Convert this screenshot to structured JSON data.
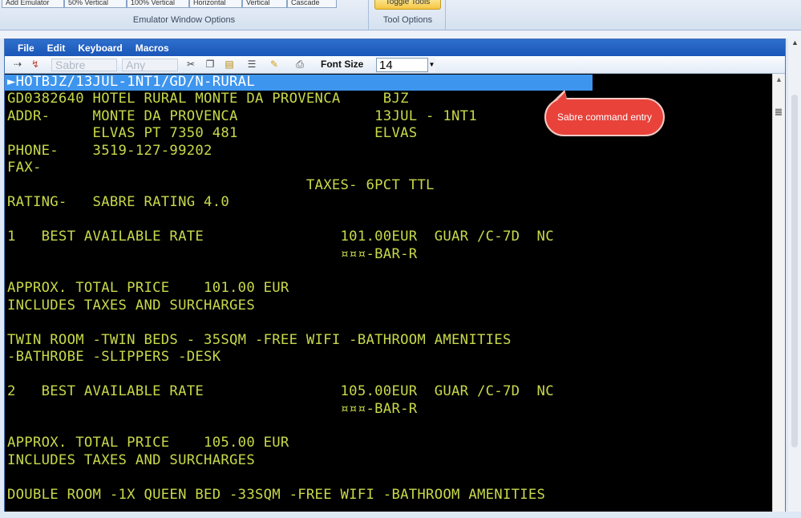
{
  "ribbon": {
    "emulator_group": {
      "buttons": [
        "Add Emulator",
        "50% Vertical",
        "100% Vertical",
        "Horizontal",
        "Vertical",
        "Cascade"
      ],
      "label": "Emulator Window Options"
    },
    "tool_group": {
      "toggle_label": "Toggle Tools",
      "label": "Tool Options"
    }
  },
  "menu": {
    "items": [
      "File",
      "Edit",
      "Keyboard",
      "Macros"
    ]
  },
  "toolbar": {
    "sabre_combo": "Sabre",
    "any_combo": "Any",
    "font_size_label": "Font Size",
    "font_size_value": "14"
  },
  "terminal": {
    "command": "►HOTBJZ/13JUL-1NT1/GD/N-RURAL",
    "lines": [
      "GD0382640 HOTEL RURAL MONTE DA PROVENCA     BJZ",
      "ADDR-     MONTE DA PROVENCA                13JUL - 1NT1",
      "          ELVAS PT 7350 481                ELVAS",
      "PHONE-    3519-127-99202",
      "FAX-",
      "                                   TAXES- 6PCT TTL",
      "RATING-   SABRE RATING 4.0",
      "",
      "1   BEST AVAILABLE RATE                101.00EUR  GUAR /C-7D  NC",
      "                                       ¤¤¤-BAR-R",
      "",
      "APPROX. TOTAL PRICE    101.00 EUR",
      "INCLUDES TAXES AND SURCHARGES",
      "",
      "TWIN ROOM -TWIN BEDS - 35SQM -FREE WIFI -BATHROOM AMENITIES",
      "-BATHROBE -SLIPPERS -DESK",
      "",
      "2   BEST AVAILABLE RATE                105.00EUR  GUAR /C-7D  NC",
      "                                       ¤¤¤-BAR-R",
      "",
      "APPROX. TOTAL PRICE    105.00 EUR",
      "INCLUDES TAXES AND SURCHARGES",
      "",
      "DOUBLE ROOM -1X QUEEN BED -33SQM -FREE WIFI -BATHROOM AMENITIES"
    ]
  },
  "callout": {
    "text": "Sabre command entry"
  },
  "colors": {
    "terminal_text": "#c8d84a",
    "command_highlight": "#3e95ee",
    "menubar": "#1f5fc4",
    "callout": "#e8423a"
  }
}
